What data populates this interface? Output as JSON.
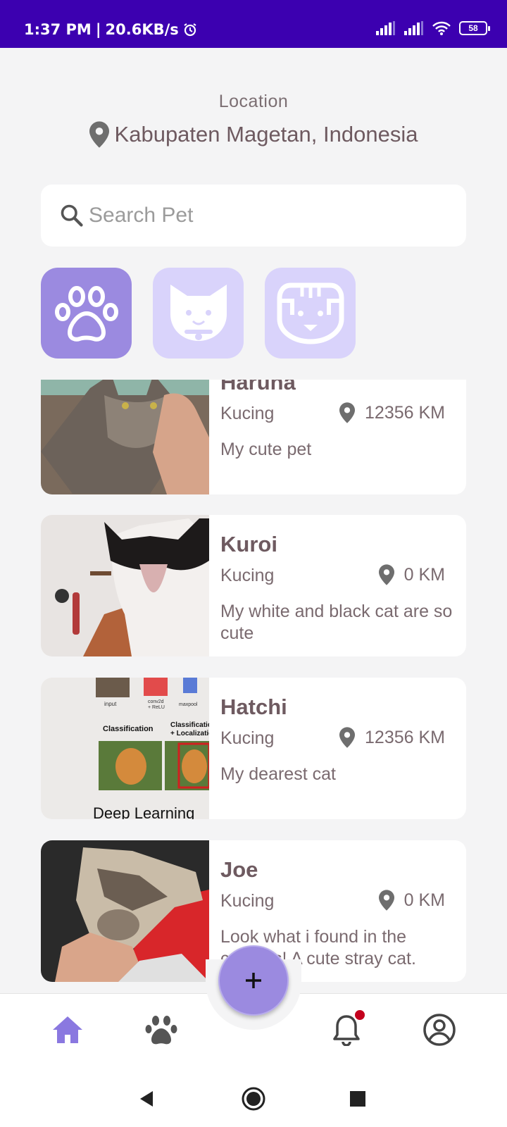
{
  "status_bar": {
    "time": "1:37 PM",
    "separator": "|",
    "speed": "20.6KB/s",
    "battery": "58"
  },
  "location": {
    "label": "Location",
    "value": "Kabupaten Magetan, Indonesia"
  },
  "search": {
    "placeholder": "Search Pet",
    "value": ""
  },
  "categories": [
    {
      "icon": "paw-icon",
      "selected": true
    },
    {
      "icon": "cat-face-icon",
      "selected": false
    },
    {
      "icon": "dog-face-icon",
      "selected": false
    }
  ],
  "pets": [
    {
      "name": "Haruna",
      "type": "Kucing",
      "distance": "12356 KM",
      "description": "My cute pet"
    },
    {
      "name": "Kuroi",
      "type": "Kucing",
      "distance": "0 KM",
      "description": "My white and black cat are so cute"
    },
    {
      "name": "Hatchi",
      "type": "Kucing",
      "distance": "12356 KM",
      "description": "My dearest cat"
    },
    {
      "name": "Joe",
      "type": "Kucing",
      "distance": "0 KM",
      "description": "Look what i found in the campus! A cute stray cat."
    }
  ],
  "hatchi_photo_text": {
    "input": "input",
    "conv": "conv2d",
    "relu": "+ ReLU",
    "maxpool": "maxpool",
    "classification": "Classification",
    "classification_loc_1": "Classification",
    "classification_loc_2": "+ Localization",
    "deep": "Deep Learning"
  },
  "bottom_nav": {
    "items": [
      "home-icon",
      "paw-icon",
      "add-icon",
      "bell-icon",
      "profile-icon"
    ],
    "has_notification": true
  },
  "colors": {
    "accent": "#9b8ae0",
    "accent_light": "#d9d3fb",
    "status_bar": "#3c00b0",
    "text": "#6e5a60",
    "notification": "#c4001d"
  }
}
